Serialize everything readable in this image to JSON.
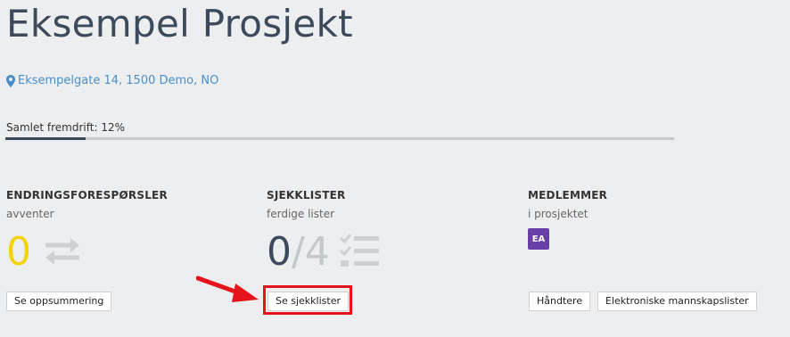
{
  "project": {
    "title": "Eksempel Prosjekt",
    "address": "Eksempelgate 14, 1500 Demo, NO"
  },
  "progress": {
    "label": "Samlet fremdrift: 12%",
    "value_fraction": 0.12
  },
  "sections": {
    "change_requests": {
      "heading": "ENDRINGSFORESPØRSLER",
      "subtitle": "avventer",
      "count": "0",
      "button": "Se oppsummering"
    },
    "checklists": {
      "heading": "SJEKKLISTER",
      "subtitle": "ferdige lister",
      "done": "0",
      "slash": "/",
      "total": "4",
      "button": "Se sjekklister"
    },
    "members": {
      "heading": "MEDLEMMER",
      "subtitle": "i prosjektet",
      "avatars": [
        "EA"
      ],
      "buttons": [
        "Håndtere",
        "Elektroniske mannskapslister"
      ]
    }
  },
  "colors": {
    "accent_yellow": "#f5d20a",
    "link_blue": "#4a8fc9",
    "avatar_purple": "#6b3fa8",
    "annotation_red": "#e5141a"
  },
  "icons": [
    "map-marker-icon",
    "swap-arrows-icon",
    "checklist-icon",
    "red-arrow-annotation"
  ]
}
